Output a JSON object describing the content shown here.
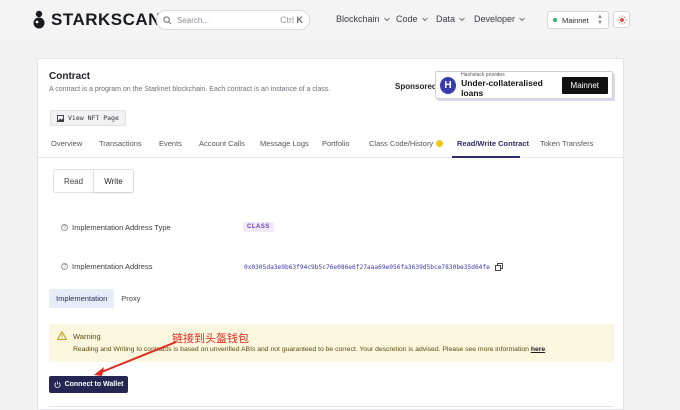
{
  "header": {
    "logo_text": "STARKSCAN",
    "search_placeholder": "Search...",
    "search_shortcut_mod": "Ctrl",
    "search_shortcut_key": "K",
    "nav": [
      {
        "label": "Blockchain"
      },
      {
        "label": "Code"
      },
      {
        "label": "Data"
      },
      {
        "label": "Developer"
      }
    ],
    "network": "Mainnet"
  },
  "contract": {
    "title": "Contract",
    "subtitle": "A contract is a program on the Starknet blockchain. Each contract is an instance of a class.",
    "sponsored_label": "Sponsored:",
    "sponsor": {
      "logo_letter": "H",
      "small": "Hashstack provides",
      "big": "Under-collateralised loans",
      "button": "Mainnet"
    },
    "nft_button": "View NFT Page",
    "tabs": [
      {
        "label": "Overview"
      },
      {
        "label": "Transactions"
      },
      {
        "label": "Events"
      },
      {
        "label": "Account Calls"
      },
      {
        "label": "Message Logs"
      },
      {
        "label": "Portfolio"
      },
      {
        "label": "Class Code/History"
      },
      {
        "label": "Read/Write Contract"
      },
      {
        "label": "Token Transfers"
      }
    ],
    "rw": {
      "read": "Read",
      "write": "Write"
    },
    "impl_type_label": "Implementation Address Type",
    "impl_type_value": "CLASS",
    "impl_addr_label": "Implementation Address",
    "impl_addr_value": "0x0305da3e9b63f94c9b5c76e086e6f27aaa69e056fa3639d5bce7830be35d64fe",
    "impl_tabs": {
      "implementation": "Implementation",
      "proxy": "Proxy"
    },
    "warning": {
      "title": "Warning",
      "text": "Reading and Writing to contracts is based on unverified ABIs and not guaranteed to be correct. Your descretion is advised. Please see more information",
      "link": "here"
    },
    "connect_button": "Connect to Wallet"
  },
  "annotation": {
    "text": "链接到头盔钱包",
    "color": "#e02a1e"
  },
  "colors": {
    "primary": "#262652",
    "tab_active": "#2c2c6e",
    "badge_bg": "#f1e9fb",
    "warning_bg": "#fbf7df"
  }
}
